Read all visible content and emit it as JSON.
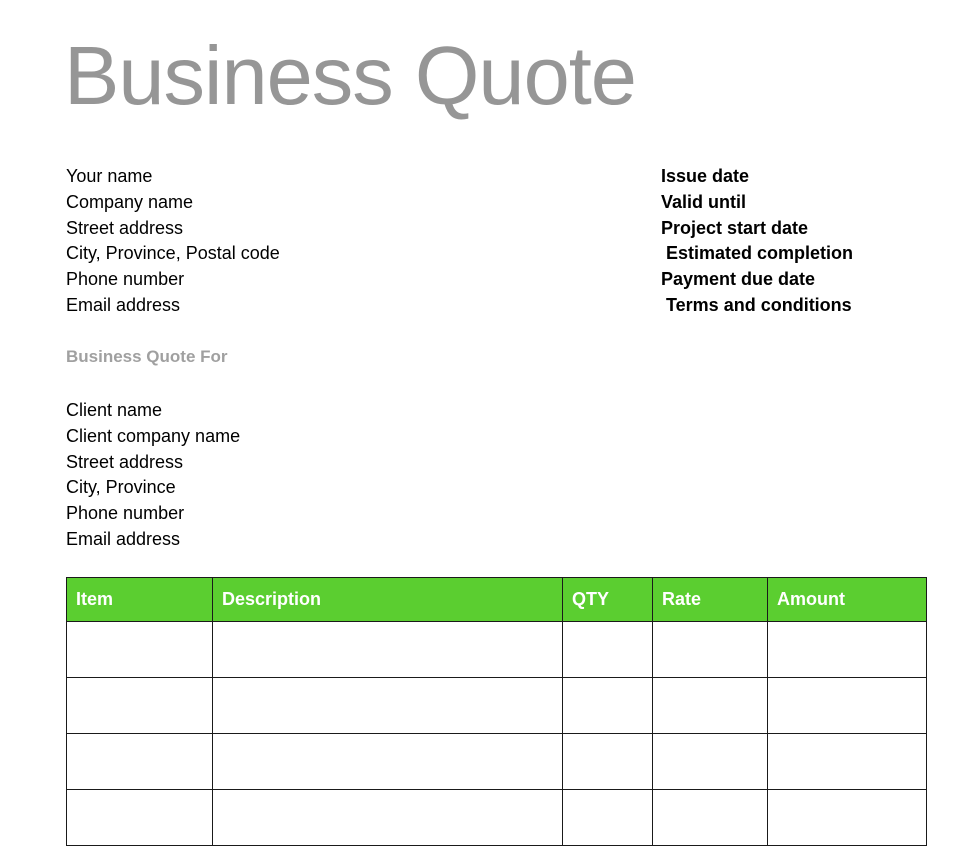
{
  "document": {
    "title": "Business Quote"
  },
  "sender": {
    "lines": [
      "Your name",
      "Company name",
      "Street address",
      "City, Province, Postal code",
      "Phone number",
      "Email address"
    ]
  },
  "meta": {
    "lines": [
      "Issue date",
      "Valid until",
      "Project start date",
      " Estimated completion",
      "Payment due date",
      " Terms and conditions"
    ]
  },
  "quote_for": {
    "heading": "Business Quote For",
    "lines": [
      "Client name",
      "Client company name",
      "Street address",
      "City, Province",
      "Phone number",
      "Email address"
    ]
  },
  "items_table": {
    "headers": [
      "Item",
      "Description",
      "QTY",
      "Rate",
      "Amount"
    ],
    "rows": [
      [
        "",
        "",
        "",
        "",
        ""
      ],
      [
        "",
        "",
        "",
        "",
        ""
      ],
      [
        "",
        "",
        "",
        "",
        ""
      ],
      [
        "",
        "",
        "",
        "",
        ""
      ]
    ],
    "header_background": "#5BCE30",
    "header_text_color": "#FFFFFF",
    "border_color": "#1A1A1A"
  },
  "colors": {
    "title_gray": "#969696",
    "heading_gray": "#A0A0A0",
    "body_black": "#000000",
    "page_background": "#FFFFFF"
  }
}
